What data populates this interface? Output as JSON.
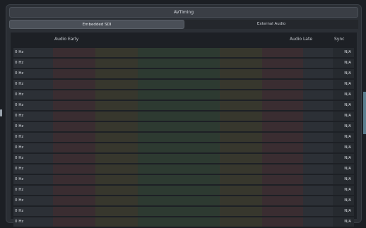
{
  "window": {
    "title": "AVTiming"
  },
  "tabs": [
    {
      "label": "Embedded SDI",
      "active": true
    },
    {
      "label": "External Audio",
      "active": false
    }
  ],
  "meter": {
    "headers": {
      "early": "Audio Early",
      "late": "Audio Late",
      "sync": "Sync"
    },
    "rows": [
      {
        "freq": "0 Hz",
        "sync": "N/A"
      },
      {
        "freq": "0 Hz",
        "sync": "N/A"
      },
      {
        "freq": "0 Hz",
        "sync": "N/A"
      },
      {
        "freq": "0 Hz",
        "sync": "N/A"
      },
      {
        "freq": "0 Hz",
        "sync": "N/A"
      },
      {
        "freq": "0 Hz",
        "sync": "N/A"
      },
      {
        "freq": "0 Hz",
        "sync": "N/A"
      },
      {
        "freq": "0 Hz",
        "sync": "N/A"
      },
      {
        "freq": "0 Hz",
        "sync": "N/A"
      },
      {
        "freq": "0 Hz",
        "sync": "N/A"
      },
      {
        "freq": "0 Hz",
        "sync": "N/A"
      },
      {
        "freq": "0 Hz",
        "sync": "N/A"
      },
      {
        "freq": "0 Hz",
        "sync": "N/A"
      },
      {
        "freq": "0 Hz",
        "sync": "N/A"
      },
      {
        "freq": "0 Hz",
        "sync": "N/A"
      },
      {
        "freq": "0 Hz",
        "sync": "N/A"
      },
      {
        "freq": "0 Hz",
        "sync": "N/A"
      }
    ]
  },
  "colors": {
    "early_late_zone": "#3a2d31",
    "warning_zone": "#37372d",
    "in_sync_zone": "#2d3a31"
  }
}
